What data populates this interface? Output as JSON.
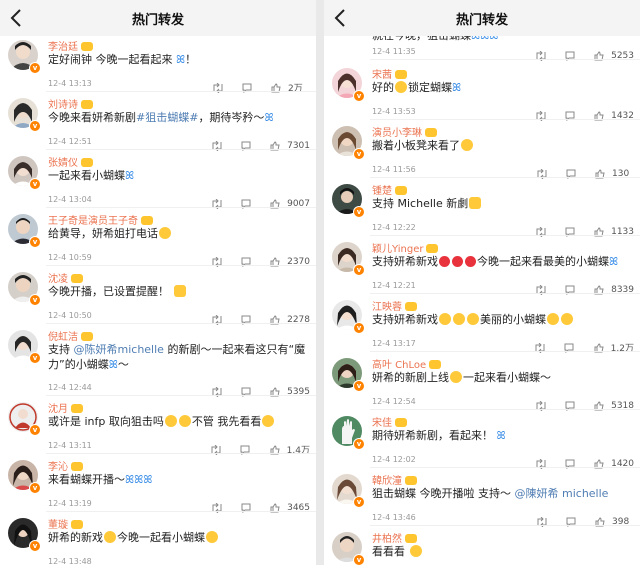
{
  "colors": {
    "username": "#eb7350",
    "link": "#4f7db3",
    "vip_badge": "#ff8200",
    "level_badge": "#ffc52e",
    "butterfly": "#3c8fe8"
  },
  "icons": {
    "back": "chevron-left-icon",
    "repost": "repost-icon",
    "comment": "comment-bubble-icon",
    "like": "thumbs-up-icon",
    "emoji": "emoji-face-icon",
    "butterfly": "butterfly-emoji"
  },
  "left_panel": {
    "title": "热门转发",
    "comments": [
      {
        "user": "李治廷",
        "text_a": "定好闹钟 今晚一起看起来",
        "text_b": "！",
        "meta": "12-4 13:13",
        "likes": "2万"
      },
      {
        "user": "刘诗诗",
        "text_a": "今晚来看妍希新剧",
        "topic": "#狙击蝴蝶#",
        "text_b": "，期待岑矜～",
        "meta": "12-4 12:51",
        "likes": "7301"
      },
      {
        "user": "张婧仪",
        "text_a": "一起来看小蝴蝶",
        "text_b": "",
        "meta": "12-4 13:04",
        "likes": "9007"
      },
      {
        "user": "王子奇是演员王子奇",
        "text_a": "给黄导，妍希姐打电话",
        "text_b": "",
        "meta": "12-4 10:59",
        "likes": "2370"
      },
      {
        "user": "沈凌",
        "text_a": "今晚开播，已设置提醒！",
        "text_b": "",
        "meta": "12-4 10:50",
        "likes": "2278"
      },
      {
        "user": "倪虹洁",
        "text_a": "支持",
        "mention": "@陈妍希michelle",
        "text_b": "的新剧～一起来看这只有“魔力”的小蝴蝶",
        "text_c": "～",
        "meta": "12-4 12:44",
        "likes": "5395"
      },
      {
        "user": "沈月",
        "text_a": "或许是 infp 取向狙击吗",
        "text_b": "不管 我先看看",
        "meta": "12-4 13:11",
        "likes": "1.4万"
      },
      {
        "user": "李沁",
        "text_a": "来看蝴蝶开播～",
        "text_b": "",
        "meta": "12-4 13:19",
        "likes": "3465"
      },
      {
        "user": "董璇",
        "text_a": "妍希的新戏",
        "text_b": "今晚一起看小蝴蝶",
        "meta": "12-4 13:48",
        "likes": ""
      }
    ]
  },
  "right_panel": {
    "title": "热门转发",
    "comments": [
      {
        "user": "",
        "text_a": "就在今晚，狙击蝴蝶",
        "text_b": "",
        "meta": "12-4 11:35",
        "likes": "5253"
      },
      {
        "user": "宋茜",
        "text_a": "好的",
        "text_b": "锁定蝴蝶",
        "meta": "12-4 13:53",
        "likes": "1432"
      },
      {
        "user": "演员小李琳",
        "text_a": "搬着小板凳来看了",
        "text_b": "",
        "meta": "12-4 11:56",
        "likes": "130"
      },
      {
        "user": "锺楚",
        "text_a": "支持 Michelle 新劇",
        "text_b": "",
        "meta": "12-4 12:22",
        "likes": "1133"
      },
      {
        "user": "颖儿Yinger",
        "text_a": "支持妍希新戏",
        "text_b": "今晚一起来看最美的小蝴蝶",
        "meta": "12-4 12:21",
        "likes": "8339"
      },
      {
        "user": "江映蓉",
        "text_a": "支持妍希新戏",
        "text_b": "美丽的小蝴蝶",
        "meta": "12-4 13:17",
        "likes": "1.2万"
      },
      {
        "user": "高叶 ChLoe",
        "text_a": "妍希的新剧上线",
        "text_b": "一起来看小蝴蝶～",
        "meta": "12-4 12:54",
        "likes": "5318"
      },
      {
        "user": "宋佳",
        "text_a": "期待妍希新剧，看起来！",
        "text_b": "",
        "meta": "12-4 12:02",
        "likes": "1420"
      },
      {
        "user": "韓欣潼",
        "text_a": "狙击蝴蝶 今晚开播啦 支持～",
        "mention": "@陳妍希 michelle",
        "text_b": "",
        "meta": "12-4 13:46",
        "likes": "398"
      },
      {
        "user": "井柏然",
        "text_a": "看看看",
        "text_b": "",
        "meta": "",
        "likes": ""
      }
    ]
  }
}
